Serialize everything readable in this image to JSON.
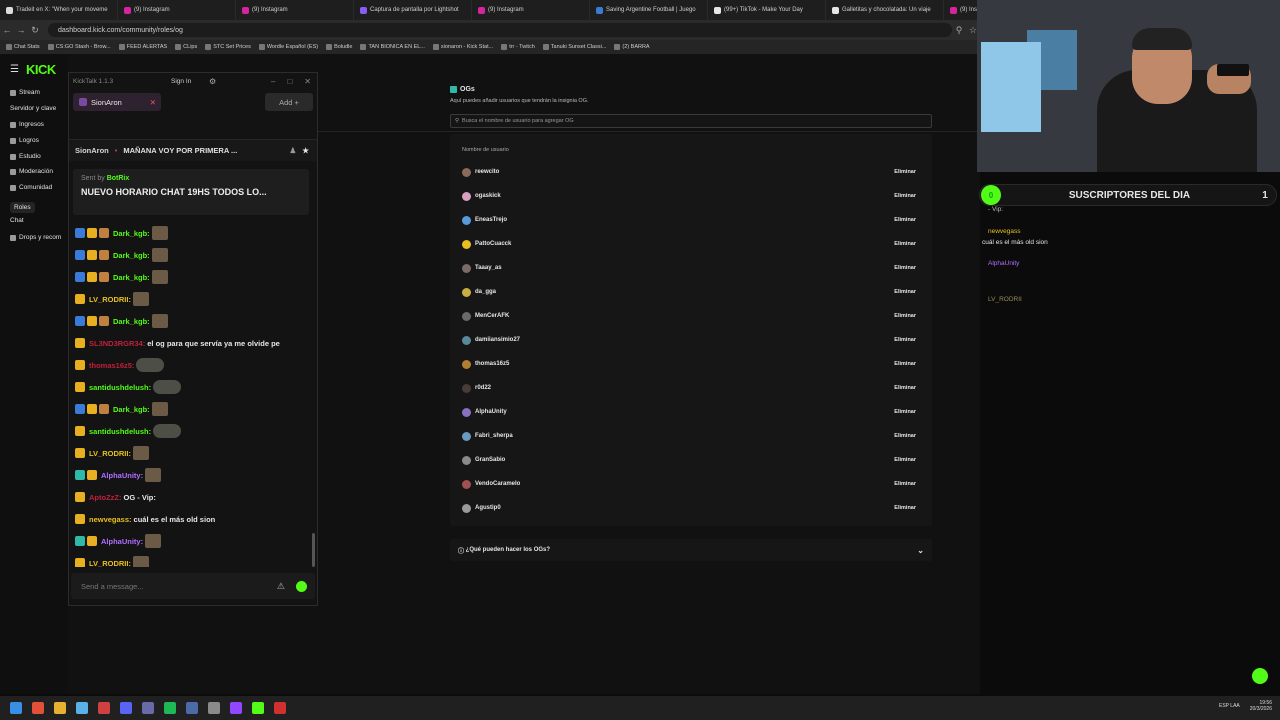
{
  "browser": {
    "tabs": [
      {
        "title": "Tradeit en X: \"When your moveme",
        "color": "#dddddd"
      },
      {
        "title": "(9) Instagram",
        "color": "#d6249f"
      },
      {
        "title": "(9) Instagram",
        "color": "#d6249f"
      },
      {
        "title": "Captura de pantalla por Lightshot",
        "color": "#8a5cf6"
      },
      {
        "title": "(9) Instagram",
        "color": "#d6249f"
      },
      {
        "title": "Saving Argentine Football | Juego",
        "color": "#3a7bd5"
      },
      {
        "title": "(99+) TikTok - Make Your Day",
        "color": "#e6e6e6"
      },
      {
        "title": "Galletitas y chocolatada: Un viaje",
        "color": "#e6e6e6"
      },
      {
        "title": "(9) Ins",
        "color": "#d6249f"
      }
    ],
    "url": "dashboard.kick.com/community/roles/og",
    "bookmarks": [
      "Chat Stats",
      "CS:GO Stash - Brow...",
      "FEED ALERTAS",
      "CLips",
      "STC Set Prices",
      "Wordle Español (ES)",
      "Boludle",
      "TAN BIONICA EN EL...",
      "sionaron - Kick Stat...",
      "trr - Twitch",
      "Tanuki Sunset Classi...",
      "(2) BARRA"
    ]
  },
  "kick": {
    "logo": "KICK",
    "sidebar": [
      {
        "label": "Stream"
      },
      {
        "label": "Servidor y clave"
      },
      {
        "label": "Ingresos"
      },
      {
        "label": "Logros"
      },
      {
        "label": "Estudio"
      },
      {
        "label": "Moderación"
      },
      {
        "label": "Comunidad"
      },
      {
        "label": "Roles"
      },
      {
        "label": "Chat"
      },
      {
        "label": "Drops y recom"
      }
    ],
    "og": {
      "title": "OGs",
      "subtitle": "Aquí puedes añadir usuarios que tendrán la insignia OG.",
      "search_placeholder": "Busca el nombre de usuario para agregar OG",
      "column_header": "Nombre de usuario",
      "remove_label": "Eliminar",
      "users": [
        {
          "name": "reewcito",
          "avatar": "#8a6a5a"
        },
        {
          "name": "ogaskick",
          "avatar": "#d8a0c0"
        },
        {
          "name": "EneasTrejo",
          "avatar": "#5a9ad8"
        },
        {
          "name": "PattoCuacck",
          "avatar": "#e8c020"
        },
        {
          "name": "Taaay_as",
          "avatar": "#7a6a6a"
        },
        {
          "name": "da_gga",
          "avatar": "#c8b040"
        },
        {
          "name": "MenCerAFK",
          "avatar": "#6a6a6a"
        },
        {
          "name": "damiiansimio27",
          "avatar": "#5a8a9a"
        },
        {
          "name": "thomas16z5",
          "avatar": "#b08030"
        },
        {
          "name": "r0d22",
          "avatar": "#4a3a3a"
        },
        {
          "name": "AlphaUnity",
          "avatar": "#8a70c0"
        },
        {
          "name": "Fabri_sherpa",
          "avatar": "#6a9ac0"
        },
        {
          "name": "GranSabio",
          "avatar": "#8a8a8a"
        },
        {
          "name": "VendoCaramelo",
          "avatar": "#a05050"
        },
        {
          "name": "Agustip0",
          "avatar": "#9a9a9a"
        }
      ],
      "faq": "¿Qué pueden hacer los OGs?"
    }
  },
  "kicktalk": {
    "title": "KickTalk 1.1.3",
    "sign_in": "Sign In",
    "tab": "SionAron",
    "add": "Add",
    "channel": "SionAron",
    "stream_title": "MAÑANA VOY POR PRIMERA ...",
    "pinned": {
      "sent_by_label": "Sent by",
      "sender": "BotRix",
      "message": "NUEVO HORARIO CHAT 19HS TODOS LO..."
    },
    "messages": [
      {
        "user": "Dark_kgb:",
        "color": "#53fc18",
        "text": ""
      },
      {
        "user": "Dark_kgb:",
        "color": "#53fc18",
        "text": ""
      },
      {
        "user": "Dark_kgb:",
        "color": "#53fc18",
        "text": ""
      },
      {
        "user": "LV_RODRII:",
        "color": "#e8c020",
        "text": ""
      },
      {
        "user": "Dark_kgb:",
        "color": "#53fc18",
        "text": ""
      },
      {
        "user": "SL3ND3RGR34:",
        "color": "#c0203a",
        "text": "el og para que servía ya me olvide pe"
      },
      {
        "user": "thomas16z5:",
        "color": "#c0203a",
        "text": ""
      },
      {
        "user": "santidushdelush:",
        "color": "#53fc18",
        "text": ""
      },
      {
        "user": "Dark_kgb:",
        "color": "#53fc18",
        "text": ""
      },
      {
        "user": "santidushdelush:",
        "color": "#53fc18",
        "text": ""
      },
      {
        "user": "LV_RODRII:",
        "color": "#e8c020",
        "text": ""
      },
      {
        "user": "AlphaUnity:",
        "color": "#b070ff",
        "text": ""
      },
      {
        "user": "AptoZzZ:",
        "color": "#c0203a",
        "text": "OG - Vip:"
      },
      {
        "user": "newvegass:",
        "color": "#e8c020",
        "text": "cuál es el más old sion"
      },
      {
        "user": "AlphaUnity:",
        "color": "#b070ff",
        "text": ""
      },
      {
        "user": "LV_RODRII:",
        "color": "#e8c020",
        "text": ""
      }
    ],
    "input_placeholder": "Send a message..."
  },
  "overlay": {
    "subs_label": "SUSCRIPTORES DEL DIA",
    "subs_left": "0",
    "subs_right": "1",
    "chat": [
      {
        "user": "- Vip:",
        "text": "",
        "color": "#bbbbbb"
      },
      {
        "user": "newvegass",
        "text": "cuál es el más old sion",
        "color": "#e8c020"
      },
      {
        "user": "AlphaUnity",
        "text": "",
        "color": "#b070ff"
      },
      {
        "user": "LV_RODRII",
        "text": "",
        "color": "#9a8a60"
      }
    ]
  },
  "taskbar": {
    "lang": "ESP LAA",
    "time": "19:56",
    "date": "20/3/2026"
  }
}
